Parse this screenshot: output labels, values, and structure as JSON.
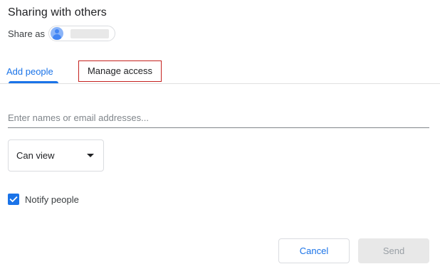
{
  "dialog": {
    "title": "Sharing with others",
    "share_as_label": "Share as"
  },
  "tabs": [
    {
      "label": "Add people",
      "active": true
    },
    {
      "label": "Manage access",
      "active": false
    }
  ],
  "email_input": {
    "placeholder": "Enter names or email addresses...",
    "value": ""
  },
  "role_select": {
    "selected": "Can view",
    "icon": "caret-down-icon"
  },
  "notify": {
    "label": "Notify people",
    "checked": true
  },
  "buttons": {
    "cancel_label": "Cancel",
    "send_label": "Send"
  },
  "colors": {
    "accent": "#1a73e8",
    "highlight_border": "#c5221f",
    "disabled_bg": "#e8e8e8",
    "disabled_text": "#9aa0a6"
  }
}
